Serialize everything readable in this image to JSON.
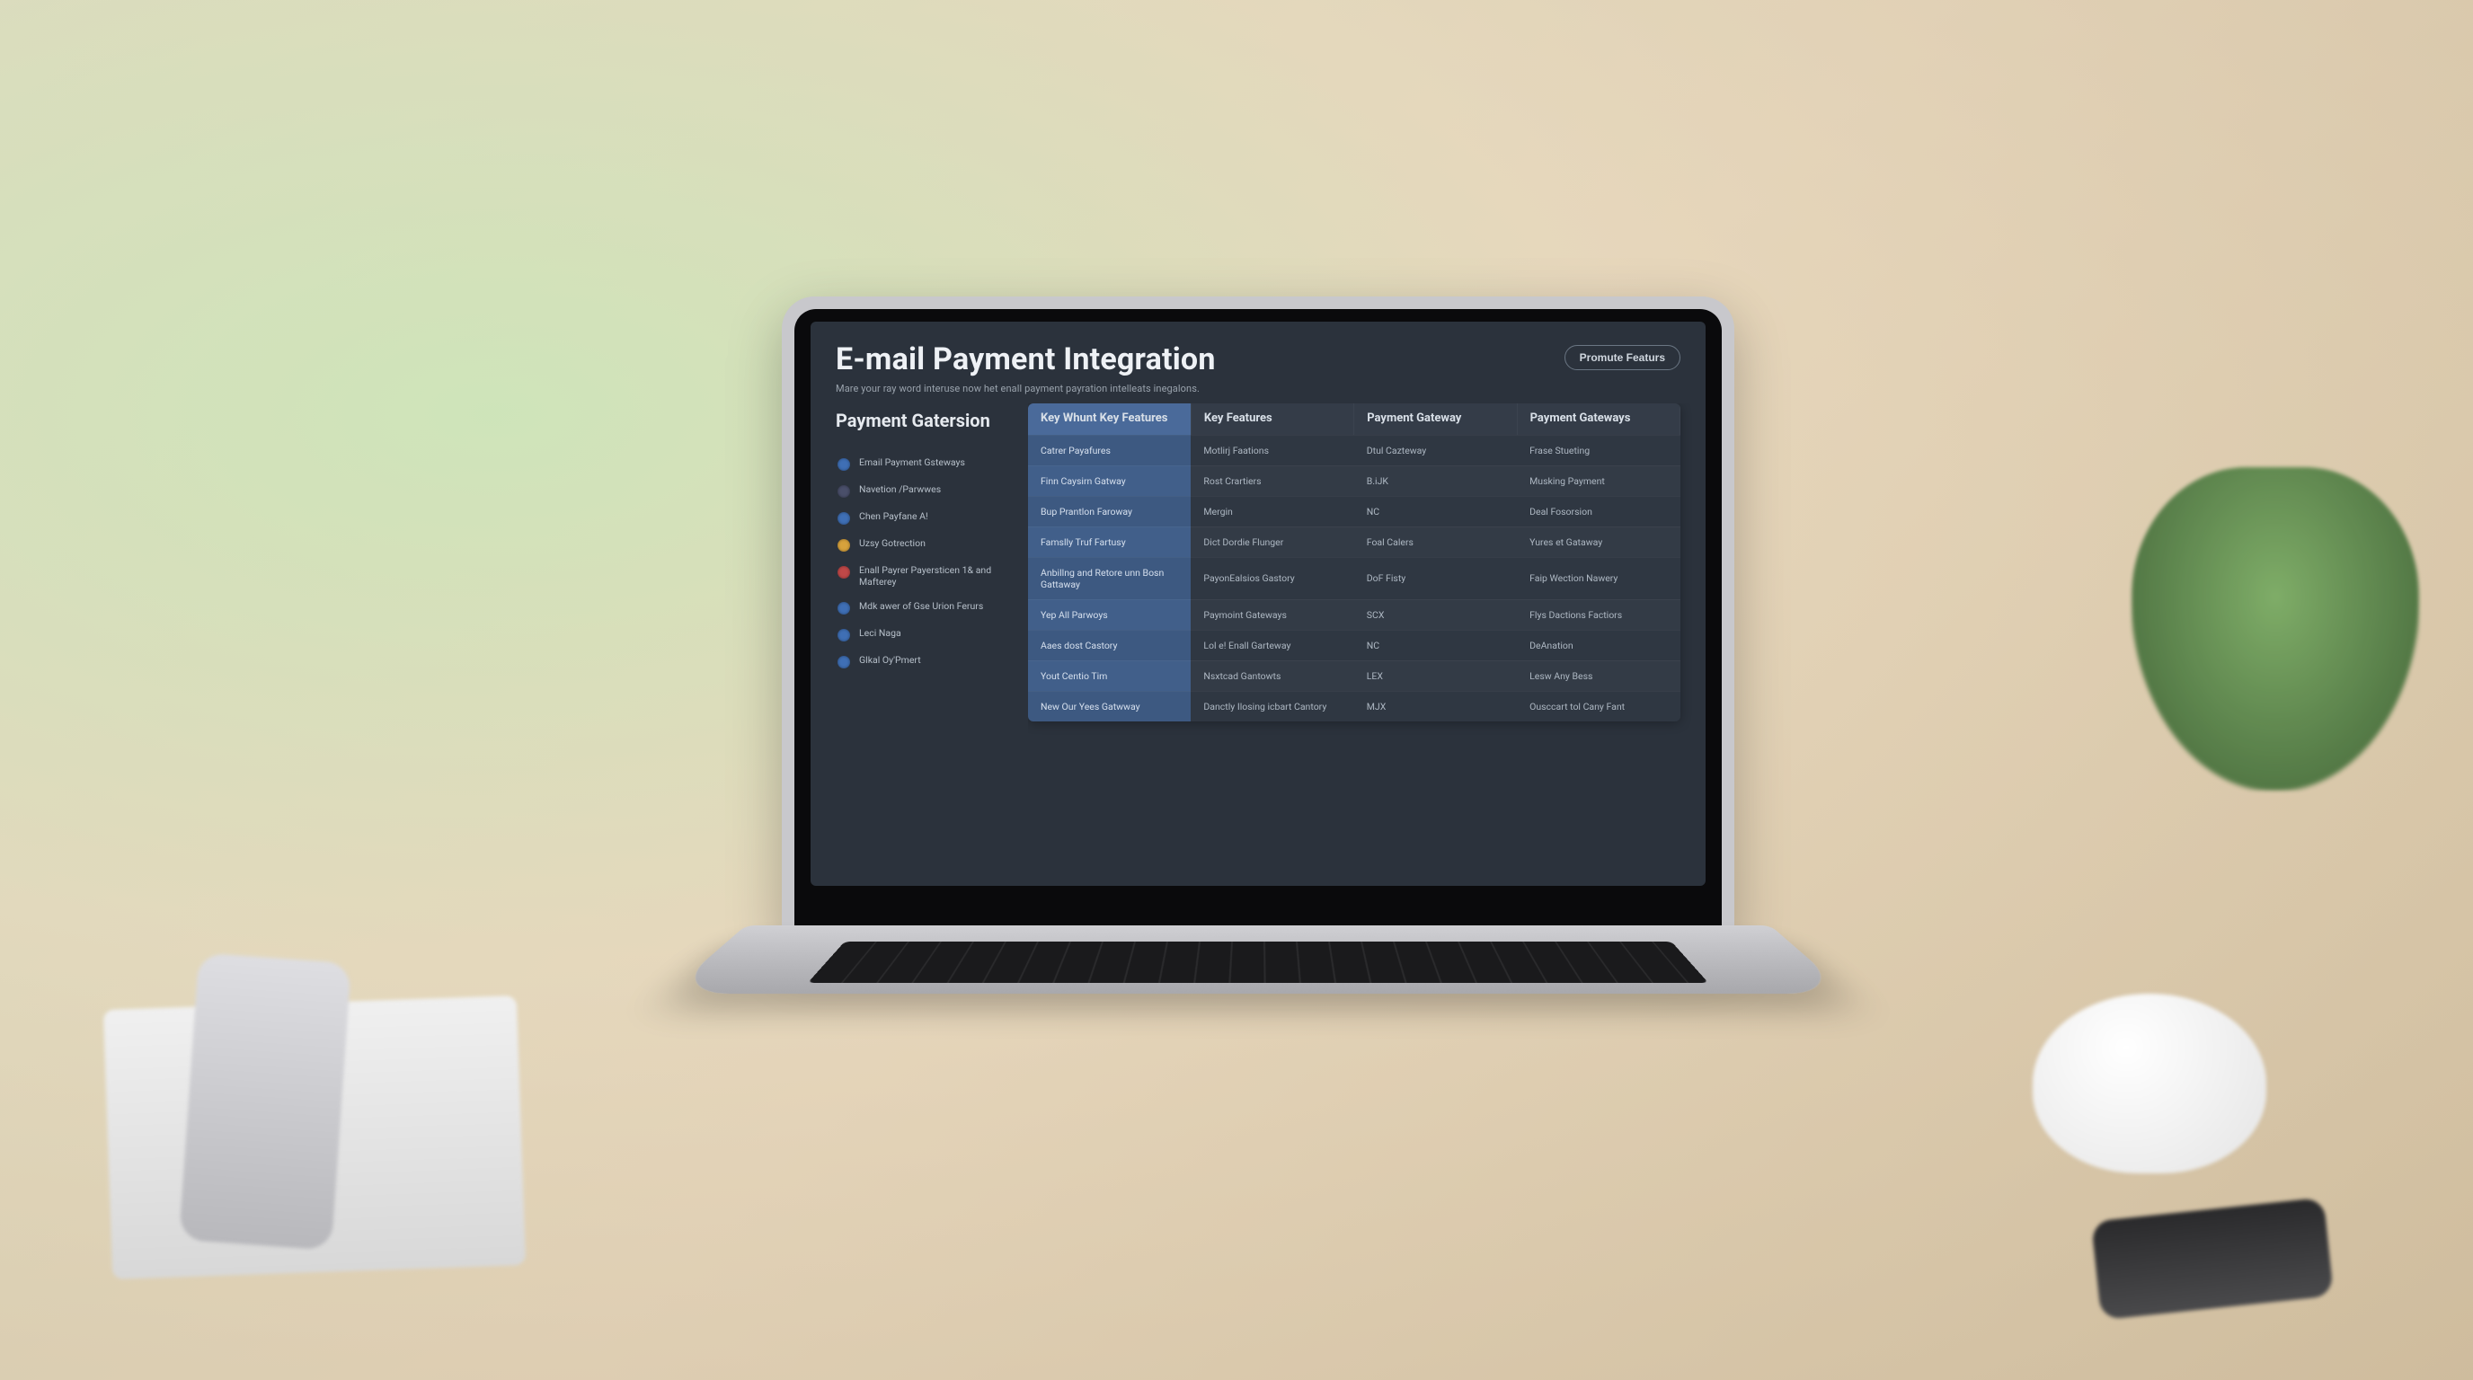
{
  "header": {
    "title": "E-mail Payment Integration",
    "subtitle": "Mare your ray word interuse now het enall payment payration intelleats inegalons.",
    "promote_button": "Promute Featurs"
  },
  "sidebar": {
    "heading": "Payment Gatersion",
    "items": [
      {
        "label": "Email Payment Gsteways",
        "bullet_color": "#3f6fb5"
      },
      {
        "label": "Navetion /Parwwes",
        "bullet_color": "#4a4f6a"
      },
      {
        "label": "Chen Payfane A!",
        "bullet_color": "#3f6fb5"
      },
      {
        "label": "Uzsy Gotrection",
        "bullet_color": "#d7a23c"
      },
      {
        "label": "Enall Payrer Payersticen 1& and Mafterey",
        "bullet_color": "#c04848"
      },
      {
        "label": "Mdk awer of Gse Urion Ferurs",
        "bullet_color": "#3f6fb5"
      },
      {
        "label": "Leci Naga",
        "bullet_color": "#3f6fb5"
      },
      {
        "label": "Glkal Oy'Pmert",
        "bullet_color": "#3f6fb5"
      }
    ]
  },
  "table": {
    "columns": [
      {
        "label": "Key Whunt Key Features",
        "highlight": true
      },
      {
        "label": "Key Features",
        "highlight": false
      },
      {
        "label": "Payment Gateway",
        "highlight": false
      },
      {
        "label": "Payment Gateways",
        "highlight": false
      }
    ],
    "rows": [
      [
        "Catrer Payafures",
        "Motlirj Faations",
        "Dtul Cazteway",
        "Frase Stueting"
      ],
      [
        "Finn Caysirn Gatway",
        "Rost Crartiers",
        "B.iJK",
        "Musking Payment"
      ],
      [
        "Bup Prantlon Faroway",
        "Mergin",
        "NC",
        "Deal Fosorsion"
      ],
      [
        "Famslly Truf Fartusy",
        "Dict Dordie Flunger",
        "Foal Calers",
        "Yures et Gataway"
      ],
      [
        "Anbillng and Retore unn Bosn Gattaway",
        "PayonEalsios Gastory",
        "DoF Fisty",
        "Faip Wection Nawery"
      ],
      [
        "Yep All Parwoys",
        "Paymoint Gateways",
        "SCX",
        "Flys Dactions Factiors"
      ],
      [
        "Aaes dost Castory",
        "Lol e! Enall Garteway",
        "NC",
        "DeAnation"
      ],
      [
        "Yout Centio Tim",
        "Nsxtcad Gantowts",
        "LEX",
        "Lesw Any Bess"
      ],
      [
        "New Our Yees Gatwway",
        "Danctly Ilosing icbart Cantory",
        "MJX",
        "Ousccart tol Cany Fant"
      ]
    ]
  }
}
